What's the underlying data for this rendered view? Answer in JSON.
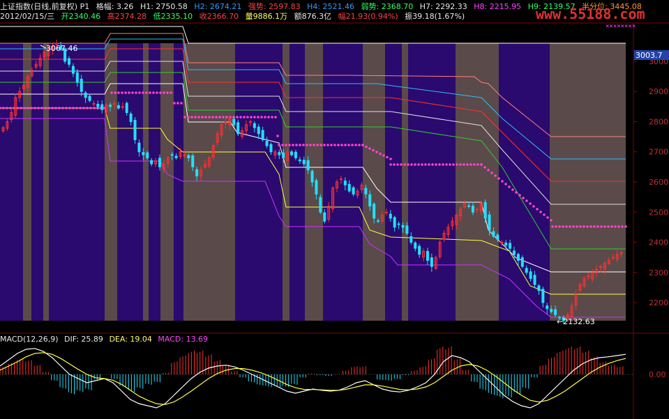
{
  "header": {
    "title": "上证指数(日线,前复权) P1",
    "grid_label": "格幅:",
    "grid_value": "3.26",
    "h1": "H1: 2750.58",
    "h2": "H2: 2674.21",
    "strong": "强势: 2597.83",
    "h4": "H4: 2521.46",
    "weak": "弱势: 2368.70",
    "h7": "H7: 2292.33",
    "h8": "H8: 2215.95",
    "h9": "H9: 2139.57",
    "half": "半分位: 3445.08",
    "date": "2012/02/15/三",
    "open": "开2340.46",
    "high": "高2374.28",
    "low": "低2335.10",
    "close": "收2366.70",
    "volume": "量9886.1万",
    "amount": "额876.3亿",
    "change": "幅21.93(0.94%)",
    "amplitude": "振39.18(1.67%)"
  },
  "watermark": "www.55188.com",
  "current_price_tag": "3003.7",
  "annotations": {
    "high_mark": "3067.46",
    "low_mark": "←2132.63"
  },
  "macd_legend": {
    "title": "MACD(12,26,9)",
    "dif": "DIF: 25.89",
    "dea": "DEA: 19.04",
    "macd": "MACD: 13.69"
  },
  "colors": {
    "background": "#000000",
    "band_dark": "#2a0a6e",
    "band_gray": "#5a4a4a",
    "up": "#ff3030",
    "down": "#22e0ff",
    "border": "#8b0000",
    "dots": "#ff44cc"
  },
  "chart_data": [
    {
      "type": "line",
      "title": "上证指数(日线,前复权)",
      "yaxis_ticks": [
        3000,
        2900,
        2800,
        2700,
        2600,
        2500,
        2400,
        2300,
        2200
      ],
      "ylim": [
        2140,
        3060
      ],
      "series": [
        {
          "name": "上证指数",
          "values": [
            2780,
            2800,
            2830,
            2880,
            2900,
            2920,
            2950,
            2970,
            2990,
            3010,
            3030,
            3040,
            3050,
            3060,
            3040,
            3000,
            2990,
            2960,
            2930,
            2900,
            2880,
            2870,
            2860,
            2850,
            2840,
            2855,
            2850,
            2860,
            2845,
            2850,
            2830,
            2800,
            2740,
            2700,
            2690,
            2680,
            2660,
            2670,
            2650,
            2660,
            2680,
            2690,
            2680,
            2700,
            2690,
            2680,
            2650,
            2620,
            2640,
            2660,
            2680,
            2720,
            2760,
            2790,
            2800,
            2810,
            2790,
            2760,
            2770,
            2790,
            2800,
            2780,
            2760,
            2740,
            2720,
            2700,
            2700,
            2690,
            2680,
            2700,
            2690,
            2680,
            2670,
            2660,
            2640,
            2600,
            2560,
            2500,
            2470,
            2520,
            2580,
            2600,
            2610,
            2590,
            2570,
            2560,
            2570,
            2590,
            2560,
            2520,
            2480,
            2470,
            2490,
            2500,
            2480,
            2450,
            2460,
            2450,
            2430,
            2400,
            2380,
            2360,
            2370,
            2340,
            2320,
            2350,
            2400,
            2430,
            2450,
            2470,
            2490,
            2510,
            2530,
            2520,
            2500,
            2510,
            2530,
            2480,
            2440,
            2420,
            2410,
            2400,
            2390,
            2380,
            2360,
            2340,
            2320,
            2300,
            2280,
            2260,
            2240,
            2200,
            2180,
            2170,
            2160,
            2150,
            2140,
            2160,
            2190,
            2230,
            2260,
            2280,
            2290,
            2300,
            2310,
            2320,
            2330,
            2340,
            2350,
            2360,
            2366
          ]
        }
      ]
    },
    {
      "type": "line",
      "title": "MACD(12,26,9)",
      "yaxis_ticks": [
        "0.00"
      ],
      "series": [
        {
          "name": "DIF",
          "values": [
            20,
            35,
            50,
            60,
            62,
            55,
            40,
            20,
            0,
            -10,
            -20,
            -15,
            -10,
            -20,
            -40,
            -60,
            -70,
            -75,
            -80,
            -70,
            -50,
            -30,
            -10,
            5,
            15,
            20,
            22,
            18,
            10,
            0,
            -10,
            -20,
            -30,
            -40,
            -45,
            -40,
            -35,
            -38,
            -40,
            -38,
            -30,
            -20,
            -15,
            -25,
            -35,
            -40,
            -42,
            -38,
            -30,
            -20,
            0,
            30,
            45,
            40,
            30,
            10,
            -10,
            -30,
            -50,
            -65,
            -75,
            -80,
            -70,
            -50,
            -30,
            -10,
            10,
            25,
            35,
            40,
            42,
            45,
            48
          ]
        },
        {
          "name": "DEA",
          "values": [
            10,
            20,
            30,
            42,
            50,
            52,
            48,
            38,
            25,
            12,
            0,
            -8,
            -10,
            -14,
            -24,
            -38,
            -52,
            -62,
            -70,
            -72,
            -66,
            -54,
            -40,
            -25,
            -10,
            2,
            10,
            14,
            14,
            10,
            4,
            -4,
            -14,
            -24,
            -32,
            -36,
            -36,
            -37,
            -38,
            -38,
            -35,
            -30,
            -25,
            -25,
            -28,
            -32,
            -36,
            -37,
            -35,
            -30,
            -20,
            -5,
            10,
            20,
            24,
            20,
            10,
            -4,
            -20,
            -36,
            -50,
            -62,
            -66,
            -62,
            -52,
            -40,
            -25,
            -10,
            5,
            17,
            26,
            33,
            38
          ]
        },
        {
          "name": "MACD",
          "values": [
            20,
            30,
            40,
            36,
            24,
            6,
            -16,
            -36,
            -50,
            -44,
            -40,
            -14,
            0,
            -12,
            -32,
            -44,
            -36,
            -26,
            -20,
            4,
            32,
            48,
            60,
            60,
            50,
            36,
            24,
            8,
            -8,
            -20,
            -28,
            -32,
            -32,
            -32,
            -26,
            -8,
            2,
            -2,
            -4,
            0,
            10,
            20,
            20,
            0,
            -14,
            -16,
            -12,
            -2,
            10,
            20,
            40,
            70,
            70,
            40,
            12,
            -20,
            -40,
            -52,
            -60,
            -58,
            -50,
            -36,
            -8,
            24,
            44,
            60,
            70,
            70,
            60,
            46,
            32,
            24,
            20
          ]
        }
      ]
    }
  ]
}
